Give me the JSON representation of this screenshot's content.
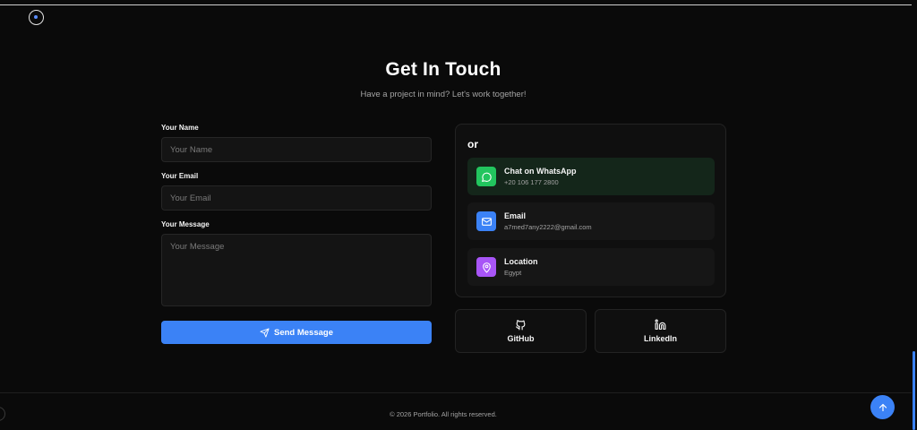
{
  "contact": {
    "heading": "Get In Touch",
    "subtitle": "Have a project in mind? Let's work together!"
  },
  "form": {
    "name_label": "Your Name",
    "name_placeholder": "Your Name",
    "name_value": "",
    "email_label": "Your Email",
    "email_placeholder": "Your Email",
    "email_value": "",
    "message_label": "Your Message",
    "message_placeholder": "Your Message",
    "message_value": "",
    "submit_label": "Send Message",
    "submit_icon": "send-icon"
  },
  "options": {
    "or_label": "or",
    "items": [
      {
        "title": "Chat on WhatsApp",
        "subtitle": "+20 106 177 2800",
        "icon": "whatsapp-icon",
        "color": "#22c55e"
      },
      {
        "title": "Email",
        "subtitle": "a7med7any2222@gmail.com",
        "icon": "mail-icon",
        "color": "#3b82f6"
      },
      {
        "title": "Location",
        "subtitle": "Egypt",
        "icon": "map-pin-icon",
        "color": "#a855f7"
      }
    ]
  },
  "social": [
    {
      "label": "GitHub",
      "icon": "github-icon"
    },
    {
      "label": "LinkedIn",
      "icon": "linkedin-icon"
    }
  ],
  "footer": {
    "copyright": "© 2026 Portfolio. All rights reserved."
  },
  "colors": {
    "background": "#0a0a0a",
    "accent": "#3b82f6"
  }
}
